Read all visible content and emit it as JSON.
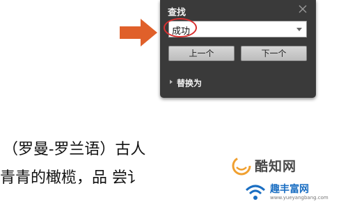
{
  "find_panel": {
    "title": "查找",
    "search_value": "成功",
    "prev_label": "上一个",
    "next_label": "下一个",
    "replace_label": "替换为"
  },
  "document": {
    "line1": "（罗曼-罗兰语）古人",
    "line2": "青青的橄榄，品 尝讠"
  },
  "watermark": {
    "brand1": "酷知网",
    "brand2": "趣丰富网",
    "url": "www.yueyangbang.com"
  },
  "colors": {
    "panel_bg": "#3a3a3a",
    "arrow": "#e0602a",
    "highlight_ring": "#d93030",
    "button_bg": "#cfcfcf"
  },
  "icons": {
    "close": "close-icon",
    "dropdown": "chevron-down-icon",
    "expand": "triangle-right-icon",
    "pointer": "arrow-right-icon"
  }
}
